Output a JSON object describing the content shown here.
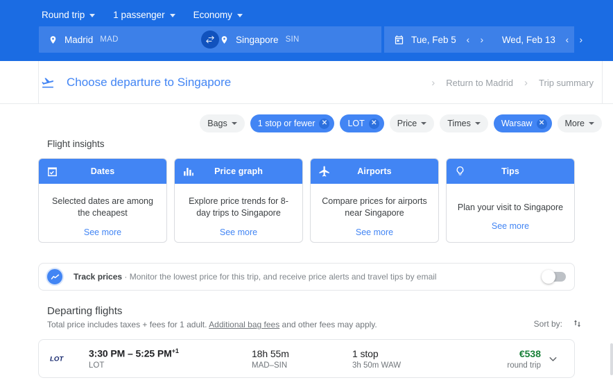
{
  "header": {
    "options": [
      {
        "label": "Round trip",
        "name": "trip-type-select"
      },
      {
        "label": "1 passenger",
        "name": "passengers-select"
      },
      {
        "label": "Economy",
        "name": "cabin-class-select"
      }
    ],
    "origin": {
      "city": "Madrid",
      "code": "MAD"
    },
    "destination": {
      "city": "Singapore",
      "code": "SIN"
    },
    "depart_date": "Tue, Feb 5",
    "return_date": "Wed, Feb 13",
    "swap_icon": "swap-horizontal-icon",
    "calendar_icon": "calendar-icon",
    "prev_icon": "‹",
    "next_icon": "›",
    "bg_color": "#1b6ce3"
  },
  "nav": {
    "title": "Choose departure to Singapore",
    "plane_icon": "takeoff-plane-icon",
    "breadcrumbs": [
      {
        "label": "Return to Madrid"
      },
      {
        "label": "Trip summary"
      }
    ],
    "separator": "›",
    "accent_color": "#4285f4"
  },
  "filters": [
    {
      "label": "Bags",
      "active": false,
      "dropdown": true
    },
    {
      "label": "1 stop or fewer",
      "active": true,
      "dropdown": false
    },
    {
      "label": "LOT",
      "active": true,
      "dropdown": false
    },
    {
      "label": "Price",
      "active": false,
      "dropdown": true
    },
    {
      "label": "Times",
      "active": false,
      "dropdown": true
    },
    {
      "label": "Warsaw",
      "active": true,
      "dropdown": false
    },
    {
      "label": "More",
      "active": false,
      "dropdown": true
    }
  ],
  "insights": {
    "section_label": "Flight insights",
    "see_more_label": "See more",
    "cards": [
      {
        "title": "Dates",
        "icon": "calendar-check-icon",
        "desc": "Selected dates are among the cheapest"
      },
      {
        "title": "Price graph",
        "icon": "bar-chart-icon",
        "desc": "Explore price trends for 8-day trips to Singapore"
      },
      {
        "title": "Airports",
        "icon": "airplane-icon",
        "desc": "Compare prices for airports near Singapore"
      },
      {
        "title": "Tips",
        "icon": "lightbulb-icon",
        "desc": "Plan your visit to Singapore"
      }
    ]
  },
  "track": {
    "icon": "trending-graph-icon",
    "title": "Track prices",
    "separator": " · ",
    "desc": "Monitor the lowest price for this trip, and receive price alerts and travel tips by email",
    "toggle_state": "off"
  },
  "departing": {
    "title": "Departing flights",
    "subtitle_before": "Total price includes taxes + fees for 1 adult. ",
    "subtitle_link": "Additional bag fees",
    "subtitle_after": " and other fees may apply.",
    "sort_label": "Sort by:",
    "sort_icon": "sort-arrows-icon"
  },
  "flights": [
    {
      "airline_logo": "lot-polish-airlines-logo",
      "times": "3:30 PM – 5:25 PM",
      "day_offset": "+1",
      "airline": "LOT",
      "duration": "18h 55m",
      "route": "MAD–SIN",
      "stops": "1 stop",
      "stop_detail": "3h 50m WAW",
      "price": "€538",
      "price_type": "round trip",
      "expand_icon": "chevron-down-icon"
    }
  ]
}
